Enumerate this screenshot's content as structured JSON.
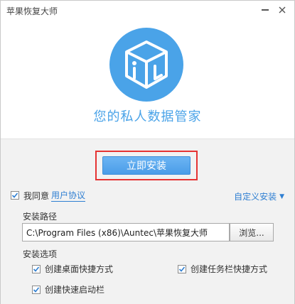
{
  "window": {
    "title": "苹果恢复大师"
  },
  "hero": {
    "slogan": "您的私人数据管家",
    "logo_icon": "cube-i-logo-icon",
    "brand_color": "#4aa3e8"
  },
  "install": {
    "button_label": "立即安装",
    "agree_label": "我同意",
    "agreement_link": "用户协议",
    "custom_install": "自定义安装"
  },
  "path": {
    "label": "安装路径",
    "value": "C:\\Program Files (x86)\\Auntec\\苹果恢复大师",
    "browse_label": "浏览..."
  },
  "options": {
    "label": "安装选项",
    "items": [
      {
        "label": "创建桌面快捷方式",
        "checked": true
      },
      {
        "label": "创建任务栏快捷方式",
        "checked": true
      },
      {
        "label": "创建快速启动栏",
        "checked": true
      }
    ]
  }
}
